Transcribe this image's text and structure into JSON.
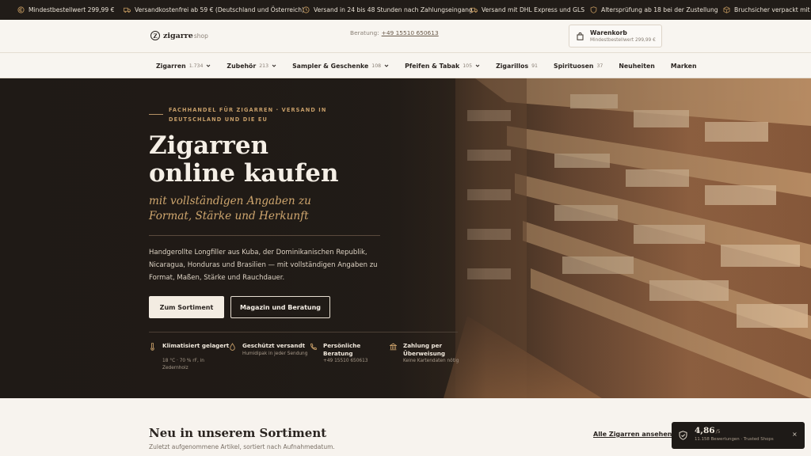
{
  "ticker": {
    "items": [
      {
        "icon": "euro-icon",
        "text": "Mindestbestellwert 299,99 €"
      },
      {
        "icon": "truck-icon",
        "text": "Versandkostenfrei ab 59 € (Deutschland und Österreich)"
      },
      {
        "icon": "clock-icon",
        "text": "Versand in 24 bis 48 Stunden nach Zahlungseingang"
      },
      {
        "icon": "truck-icon",
        "text": "Versand mit DHL Express und GLS"
      },
      {
        "icon": "shield-icon",
        "text": "Altersprüfung ab 18 bei der Zustellung"
      },
      {
        "icon": "box-icon",
        "text": "Bruchsicher verpackt mit B..."
      }
    ]
  },
  "header": {
    "logo_word": "zigarre",
    "logo_suffix": "shop",
    "logo_mark": "Z",
    "hotline_label": "Beratung:",
    "hotline_number": "+49 15510 650613",
    "cart_title": "Warenkorb",
    "cart_note": "Mindestbestellwert 299,99 €"
  },
  "nav": {
    "items": [
      {
        "label": "Zigarren",
        "count": "1.734",
        "dropdown": true
      },
      {
        "label": "Zubehör",
        "count": "213",
        "dropdown": true
      },
      {
        "label": "Sampler & Geschenke",
        "count": "108",
        "dropdown": true
      },
      {
        "label": "Pfeifen & Tabak",
        "count": "105",
        "dropdown": true
      },
      {
        "label": "Zigarillos",
        "count": "91",
        "dropdown": false
      },
      {
        "label": "Spirituosen",
        "count": "37",
        "dropdown": false
      },
      {
        "label": "Neuheiten",
        "count": "",
        "dropdown": false
      },
      {
        "label": "Marken",
        "count": "",
        "dropdown": false
      }
    ]
  },
  "hero": {
    "eyebrow": "FACHHANDEL FÜR ZIGARREN · VERSAND IN DEUTSCHLAND UND DIE EU",
    "title_line1": "Zigarren",
    "title_line2": "online kaufen",
    "subtitle_line1": "mit vollständigen Angaben zu",
    "subtitle_line2": "Format, Stärke und Herkunft",
    "lead": "Handgerollte Longfiller aus Kuba, der Dominikanischen Republik, Nicaragua, Honduras und Brasilien — mit vollständigen Angaben zu Format, Maßen, Stärke und Rauchdauer.",
    "primary_button": "Zum Sortiment",
    "secondary_button": "Magazin und Beratung",
    "features": [
      {
        "icon": "thermometer-icon",
        "title": "Klimatisiert gelagert",
        "sub": "18 °C · 70 % rF, in Zedernholz"
      },
      {
        "icon": "droplet-icon",
        "title": "Geschützt versandt",
        "sub": "Humidipak in jeder Sendung"
      },
      {
        "icon": "phone-icon",
        "title": "Persönliche Beratung",
        "sub": "+49 15510 650613"
      },
      {
        "icon": "bank-icon",
        "title": "Zahlung per Überweisung",
        "sub": "Keine Kartendaten nötig"
      }
    ]
  },
  "section": {
    "title": "Neu in unserem Sortiment",
    "subtitle": "Zuletzt aufgenommene Artikel, sortiert nach Aufnahmedatum.",
    "link": "Alle Zigarren ansehen"
  },
  "trust_badge": {
    "score": "4,86",
    "scale": "/5",
    "reviews": "11.158 Bewertungen · Trusted Shops",
    "close": "×"
  },
  "colors": {
    "accent_gold": "#c49c67",
    "dark": "#211c18",
    "cream": "#f6f2ec"
  }
}
